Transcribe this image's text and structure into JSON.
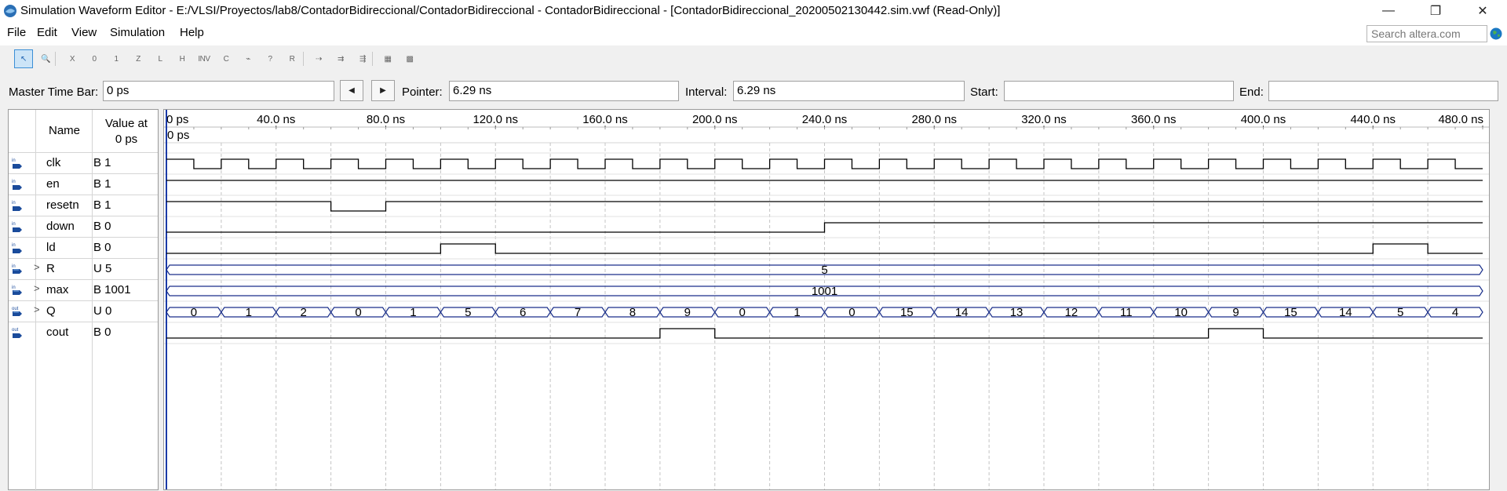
{
  "window": {
    "title": "Simulation Waveform Editor - E:/VLSI/Proyectos/lab8/ContadorBidireccional/ContadorBidireccional - ContadorBidireccional - [ContadorBidireccional_20200502130442.sim.vwf (Read-Only)]",
    "minimize_glyph": "—",
    "restore_glyph": "❐",
    "close_glyph": "✕"
  },
  "menu": [
    "File",
    "Edit",
    "View",
    "Simulation",
    "Help"
  ],
  "search": {
    "placeholder": "Search altera.com"
  },
  "toolbar": {
    "tools": [
      {
        "name": "selection-tool-icon",
        "label": "↖",
        "active": true
      },
      {
        "name": "zoom-tool-icon",
        "label": "🔍",
        "active": false
      },
      {
        "name": "force-unknown-icon",
        "label": "X"
      },
      {
        "name": "force-low-icon",
        "label": "0"
      },
      {
        "name": "force-high-icon",
        "label": "1"
      },
      {
        "name": "force-high-impedance-icon",
        "label": "Z"
      },
      {
        "name": "force-weak-low-icon",
        "label": "L"
      },
      {
        "name": "force-weak-high-icon",
        "label": "H"
      },
      {
        "name": "invert-icon",
        "label": "INV"
      },
      {
        "name": "count-value-icon",
        "label": "C"
      },
      {
        "name": "overwrite-clock-icon",
        "label": "⌁"
      },
      {
        "name": "arbitrary-value-icon",
        "label": "?"
      },
      {
        "name": "random-value-icon",
        "label": "R"
      },
      {
        "name": "snap-icon",
        "label": "⇢"
      },
      {
        "name": "group-icon",
        "label": "⇉"
      },
      {
        "name": "ungroup-icon",
        "label": "⇶"
      },
      {
        "name": "grid-icon",
        "label": "▦"
      },
      {
        "name": "waveform-settings-icon",
        "label": "▩"
      }
    ]
  },
  "timebar": {
    "master_label": "Master Time Bar:",
    "master_value": "0 ps",
    "prev_glyph": "◀",
    "next_glyph": "▶",
    "pointer_label": "Pointer:",
    "pointer_value": "6.29 ns",
    "interval_label": "Interval:",
    "interval_value": "6.29 ns",
    "start_label": "Start:",
    "start_value": "",
    "end_label": "End:",
    "end_value": ""
  },
  "name_panel": {
    "name_header": "Name",
    "value_header_line1": "Value at",
    "value_header_line2": "0 ps"
  },
  "signals": [
    {
      "name": "clk",
      "value": "B 1",
      "dir": "in",
      "expandable": false,
      "expand_glyph": ""
    },
    {
      "name": "en",
      "value": "B 1",
      "dir": "in",
      "expandable": false,
      "expand_glyph": ""
    },
    {
      "name": "resetn",
      "value": "B 1",
      "dir": "in",
      "expandable": false,
      "expand_glyph": ""
    },
    {
      "name": "down",
      "value": "B 0",
      "dir": "in",
      "expandable": false,
      "expand_glyph": ""
    },
    {
      "name": "ld",
      "value": "B 0",
      "dir": "in",
      "expandable": false,
      "expand_glyph": ""
    },
    {
      "name": "R",
      "value": "U 5",
      "dir": "in",
      "expandable": true,
      "expand_glyph": ">"
    },
    {
      "name": "max",
      "value": "B 1001",
      "dir": "in",
      "expandable": true,
      "expand_glyph": ">"
    },
    {
      "name": "Q",
      "value": "U 0",
      "dir": "out",
      "expandable": true,
      "expand_glyph": ">"
    },
    {
      "name": "cout",
      "value": "B 0",
      "dir": "out",
      "expandable": false,
      "expand_glyph": ""
    }
  ],
  "chart_data": {
    "type": "waveform",
    "time_unit": "ns",
    "xlim": [
      0,
      480
    ],
    "tick_labels": [
      "0 ps",
      "40.0 ns",
      "80.0 ns",
      "120.0 ns",
      "160.0 ns",
      "200.0 ns",
      "240.0 ns",
      "280.0 ns",
      "320.0 ns",
      "360.0 ns",
      "400.0 ns",
      "440.0 ns",
      "480.0 ns"
    ],
    "tick_times": [
      0,
      40,
      80,
      120,
      160,
      200,
      240,
      280,
      320,
      360,
      400,
      440,
      480
    ],
    "cursor_label": "0 ps",
    "cursor_time": 0,
    "clock_period": 20,
    "bits": {
      "clk": {
        "type": "clock"
      },
      "en": {
        "transitions": [
          [
            0,
            1
          ]
        ]
      },
      "resetn": {
        "transitions": [
          [
            0,
            1
          ],
          [
            60,
            0
          ],
          [
            80,
            1
          ]
        ]
      },
      "down": {
        "transitions": [
          [
            0,
            0
          ],
          [
            240,
            1
          ]
        ]
      },
      "ld": {
        "transitions": [
          [
            0,
            0
          ],
          [
            100,
            1
          ],
          [
            120,
            0
          ],
          [
            440,
            1
          ],
          [
            460,
            0
          ]
        ]
      },
      "cout": {
        "transitions": [
          [
            0,
            0
          ],
          [
            180,
            1
          ],
          [
            200,
            0
          ],
          [
            380,
            1
          ],
          [
            400,
            0
          ]
        ]
      }
    },
    "buses": {
      "R": [
        {
          "start": 0,
          "end": 480,
          "label": "5"
        }
      ],
      "max": [
        {
          "start": 0,
          "end": 480,
          "label": "1001"
        }
      ],
      "Q": [
        {
          "start": 0,
          "end": 20,
          "label": "0"
        },
        {
          "start": 20,
          "end": 40,
          "label": "1"
        },
        {
          "start": 40,
          "end": 60,
          "label": "2"
        },
        {
          "start": 60,
          "end": 80,
          "label": "0"
        },
        {
          "start": 80,
          "end": 100,
          "label": "1"
        },
        {
          "start": 100,
          "end": 120,
          "label": "5"
        },
        {
          "start": 120,
          "end": 140,
          "label": "6"
        },
        {
          "start": 140,
          "end": 160,
          "label": "7"
        },
        {
          "start": 160,
          "end": 180,
          "label": "8"
        },
        {
          "start": 180,
          "end": 200,
          "label": "9"
        },
        {
          "start": 200,
          "end": 220,
          "label": "0"
        },
        {
          "start": 220,
          "end": 240,
          "label": "1"
        },
        {
          "start": 240,
          "end": 260,
          "label": "0"
        },
        {
          "start": 260,
          "end": 280,
          "label": "15"
        },
        {
          "start": 280,
          "end": 300,
          "label": "14"
        },
        {
          "start": 300,
          "end": 320,
          "label": "13"
        },
        {
          "start": 320,
          "end": 340,
          "label": "12"
        },
        {
          "start": 340,
          "end": 360,
          "label": "11"
        },
        {
          "start": 360,
          "end": 380,
          "label": "10"
        },
        {
          "start": 380,
          "end": 400,
          "label": "9"
        },
        {
          "start": 400,
          "end": 420,
          "label": "15"
        },
        {
          "start": 420,
          "end": 440,
          "label": "14"
        },
        {
          "start": 440,
          "end": 460,
          "label": "5"
        },
        {
          "start": 460,
          "end": 480,
          "label": "4"
        }
      ]
    }
  }
}
